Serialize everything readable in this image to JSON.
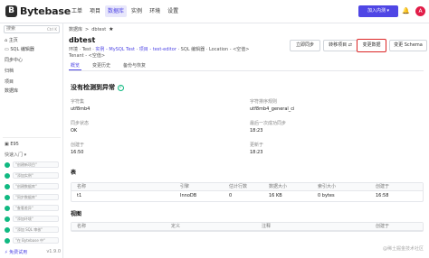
{
  "app": {
    "logo_mark": "B",
    "logo_text": "Bytebase"
  },
  "topnav": {
    "items": [
      "工单",
      "项目",
      "数据库",
      "实例",
      "环境",
      "设置"
    ],
    "active": "数据库"
  },
  "header": {
    "join_label": "加入内测 ▾",
    "avatar": "A"
  },
  "sidebar": {
    "search_placeholder": "搜索",
    "search_kbd": "Ctrl K",
    "items": [
      "主页",
      "SQL 编辑器",
      "同步中心",
      "归档",
      "项目",
      "数据库"
    ],
    "env_label": "E95",
    "quickstart_title": "快速入门 ▾",
    "quick_items": [
      "\"创建新项目\"",
      "\"添加实例\"",
      "\"创建数据库\"",
      "\"同步数据库\"",
      "\"查看差异\"",
      "\"添加环境\"",
      "\"添加 SQL 审核\"",
      "\"在 Bytebase 中\""
    ],
    "trial_label": "⚡ 免费试用",
    "version": "v1.9.0"
  },
  "breadcrumb": {
    "parent": "数据库",
    "sep": ">",
    "current": "dbtest",
    "star": "★"
  },
  "page": {
    "title": "dbtest",
    "meta_env_label": "环境 · Test",
    "meta_instance": "实例 - MySQL Test",
    "meta_project": "项目 - test-editor",
    "meta_sql_editor": "SQL 编辑器",
    "meta_location": "Location - <空值>",
    "meta_tenant": "Tenant - <空值>"
  },
  "actions": {
    "sync": "立即同步",
    "transfer": "转移项目 ⇄",
    "alter_data": "变更数据",
    "alter_schema": "变更 Schema"
  },
  "tabs": [
    "概览",
    "变更历史",
    "备份与恢复"
  ],
  "overview": {
    "healthy_text": "没有检测到异常",
    "healthy_icon": "✓",
    "fields": [
      {
        "label": "字符集",
        "value": "utf8mb4"
      },
      {
        "label": "字符排序规则",
        "value": "utf8mb4_general_ci"
      },
      {
        "label": "同步状态",
        "value": "OK"
      },
      {
        "label": "最后一次成功同步",
        "value": "18:23"
      },
      {
        "label": "创建于",
        "value": "16:50"
      },
      {
        "label": "更新于",
        "value": "18:23"
      }
    ]
  },
  "tables_section": {
    "title": "表",
    "columns": [
      "名称",
      "引擎",
      "估计行数",
      "数据大小",
      "索引大小",
      "创建于"
    ],
    "rows": [
      [
        "t1",
        "InnoDB",
        "0",
        "16 KB",
        "0 bytes",
        "16:58"
      ]
    ]
  },
  "views_section": {
    "title": "视图",
    "columns": [
      "名称",
      "定义",
      "注释",
      "创建于"
    ]
  },
  "watermark": "@稀土掘金技术社区"
}
